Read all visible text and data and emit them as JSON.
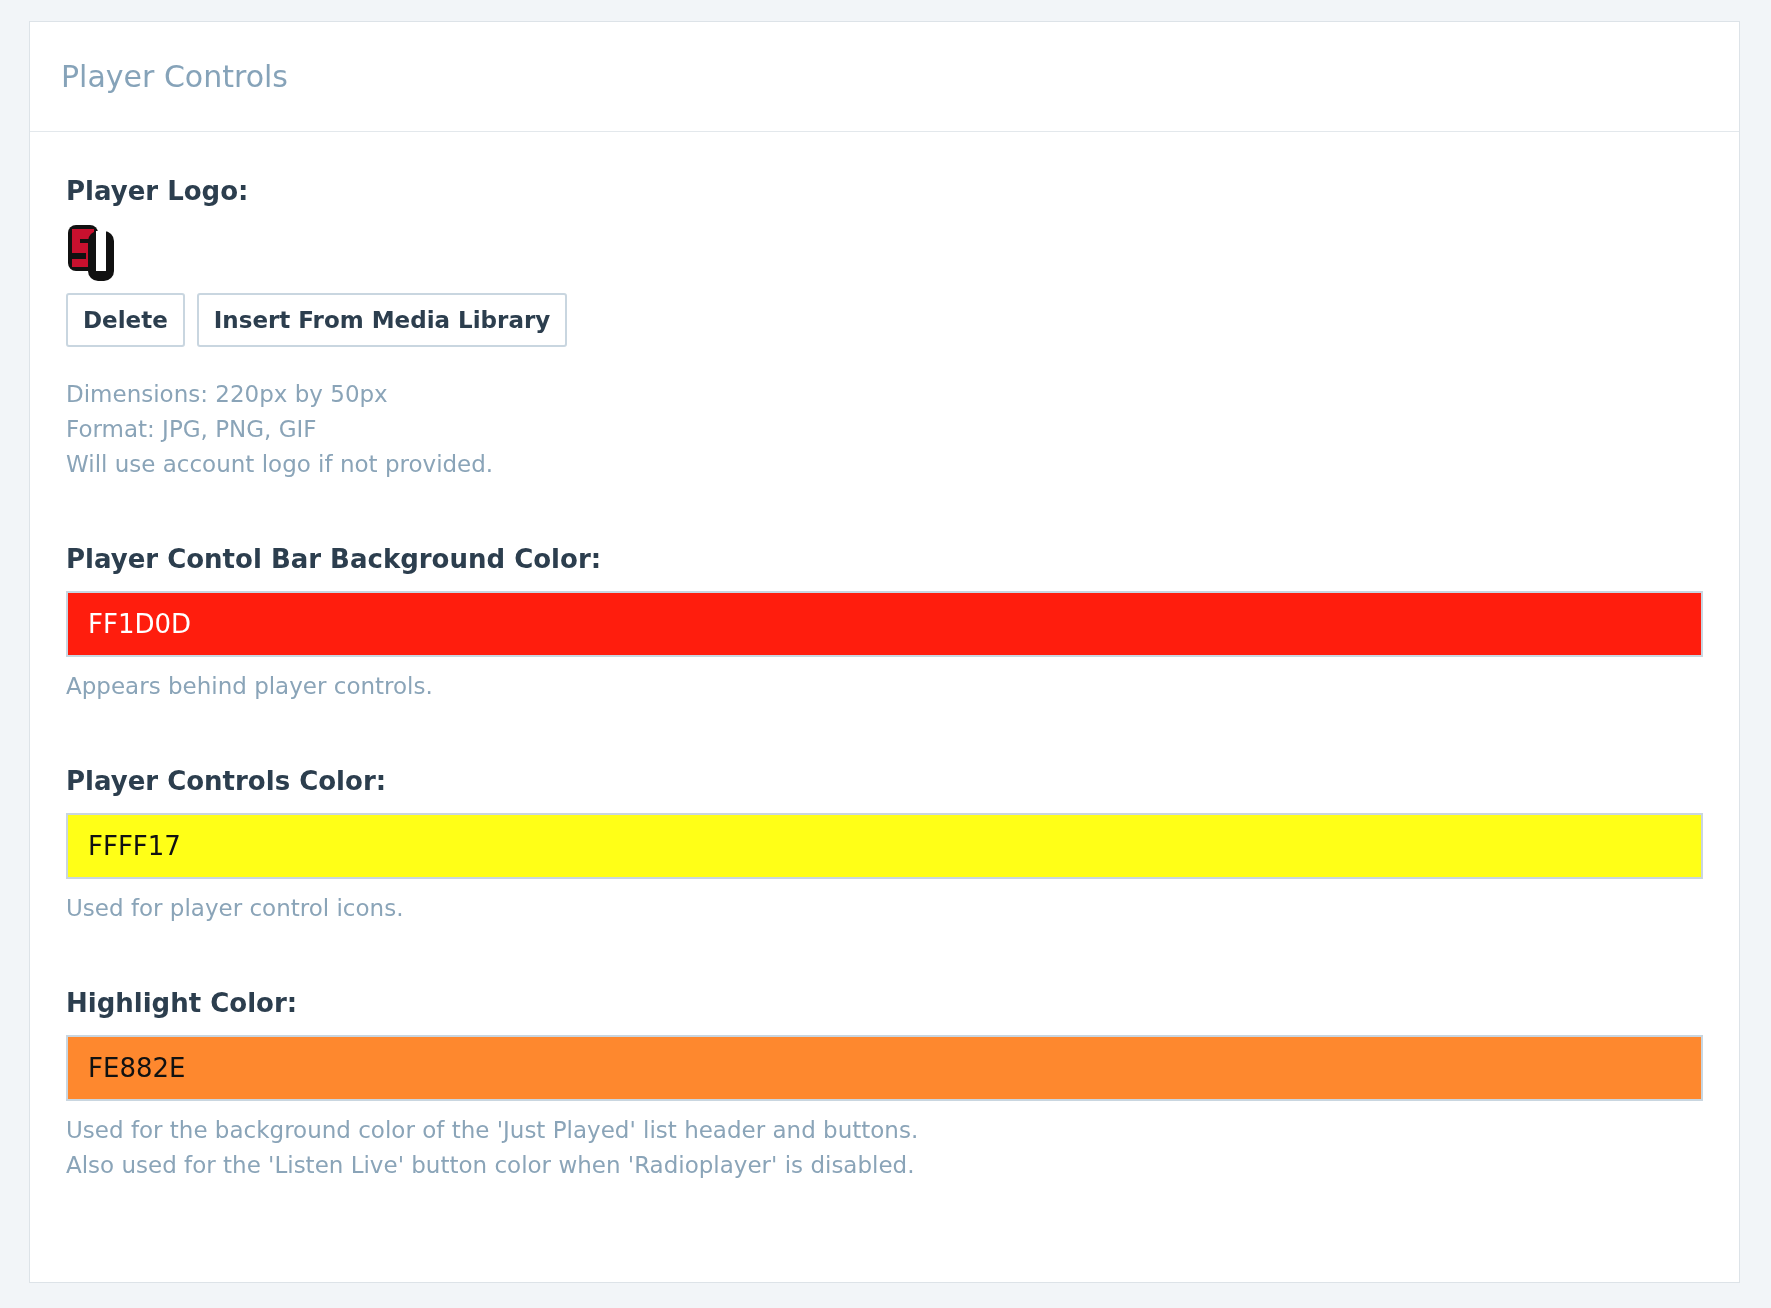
{
  "panel": {
    "title": "Player Controls"
  },
  "logo_section": {
    "label": "Player Logo:",
    "buttons": [
      "Delete",
      "Insert From Media Library"
    ],
    "help": [
      "Dimensions: 220px by 50px",
      "Format: JPG, PNG, GIF",
      "Will use account logo if not provided."
    ]
  },
  "fields": [
    {
      "label": "Player Contol Bar Background Color:",
      "value": "FF1D0D",
      "color": "#ff1d0d",
      "help": [
        "Appears behind player controls."
      ]
    },
    {
      "label": "Player Controls Color:",
      "value": "FFFF17",
      "color": "#ffff17",
      "help": [
        "Used for player control icons."
      ]
    },
    {
      "label": "Highlight Color:",
      "value": "FE882E",
      "color": "#fe882e",
      "help": [
        "Used for the background color of the 'Just Played' list header and buttons.",
        "Also used for the 'Listen Live' button color when 'Radioplayer' is disabled."
      ]
    }
  ]
}
